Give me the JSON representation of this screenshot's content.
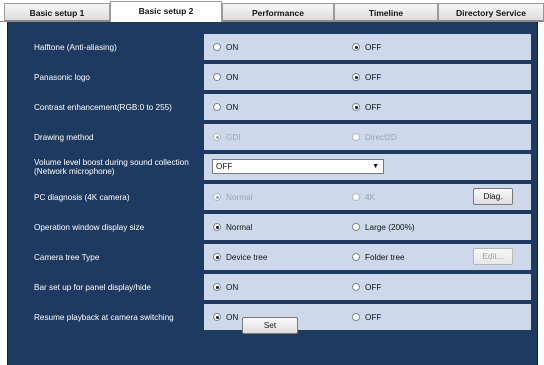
{
  "tabs": [
    {
      "label": "Basic setup 1"
    },
    {
      "label": "Basic setup 2"
    },
    {
      "label": "Performance"
    },
    {
      "label": "Timeline"
    },
    {
      "label": "Directory Service"
    }
  ],
  "active_tab": "Basic setup 2",
  "settings": {
    "halftone": {
      "label": "Halftone (Anti-aliasing)",
      "opt1": "ON",
      "opt2": "OFF",
      "selected": "OFF"
    },
    "logo": {
      "label": "Panasonic logo",
      "opt1": "ON",
      "opt2": "OFF",
      "selected": "OFF"
    },
    "contrast": {
      "label": "Contrast enhancement(RGB:0 to 255)",
      "opt1": "ON",
      "opt2": "OFF",
      "selected": "OFF"
    },
    "drawing": {
      "label": "Drawing method",
      "opt1": "GDI",
      "opt2": "Direct2D",
      "selected": "GDI",
      "disabled": true
    },
    "volume": {
      "label": "Volume level boost during sound collection (Network microphone)",
      "value": "OFF"
    },
    "pcdiag": {
      "label": "PC diagnosis (4K camera)",
      "opt1": "Normal",
      "opt2": "4K",
      "selected": "Normal",
      "disabled": true,
      "button": "Diag."
    },
    "opwin": {
      "label": "Operation window display size",
      "opt1": "Normal",
      "opt2": "Large (200%)",
      "selected": "Normal"
    },
    "tree": {
      "label": "Camera tree Type",
      "opt1": "Device tree",
      "opt2": "Folder tree",
      "selected": "Device tree",
      "button": "Edit..."
    },
    "bar": {
      "label": "Bar set up for panel display/hide",
      "opt1": "ON",
      "opt2": "OFF",
      "selected": "ON"
    },
    "resume": {
      "label": "Resume playback at camera switching",
      "opt1": "ON",
      "opt2": "OFF",
      "selected": "ON"
    }
  },
  "set_button": "Set",
  "colors": {
    "panel": "#1e3a60",
    "value_cell": "#cdd9ea"
  }
}
